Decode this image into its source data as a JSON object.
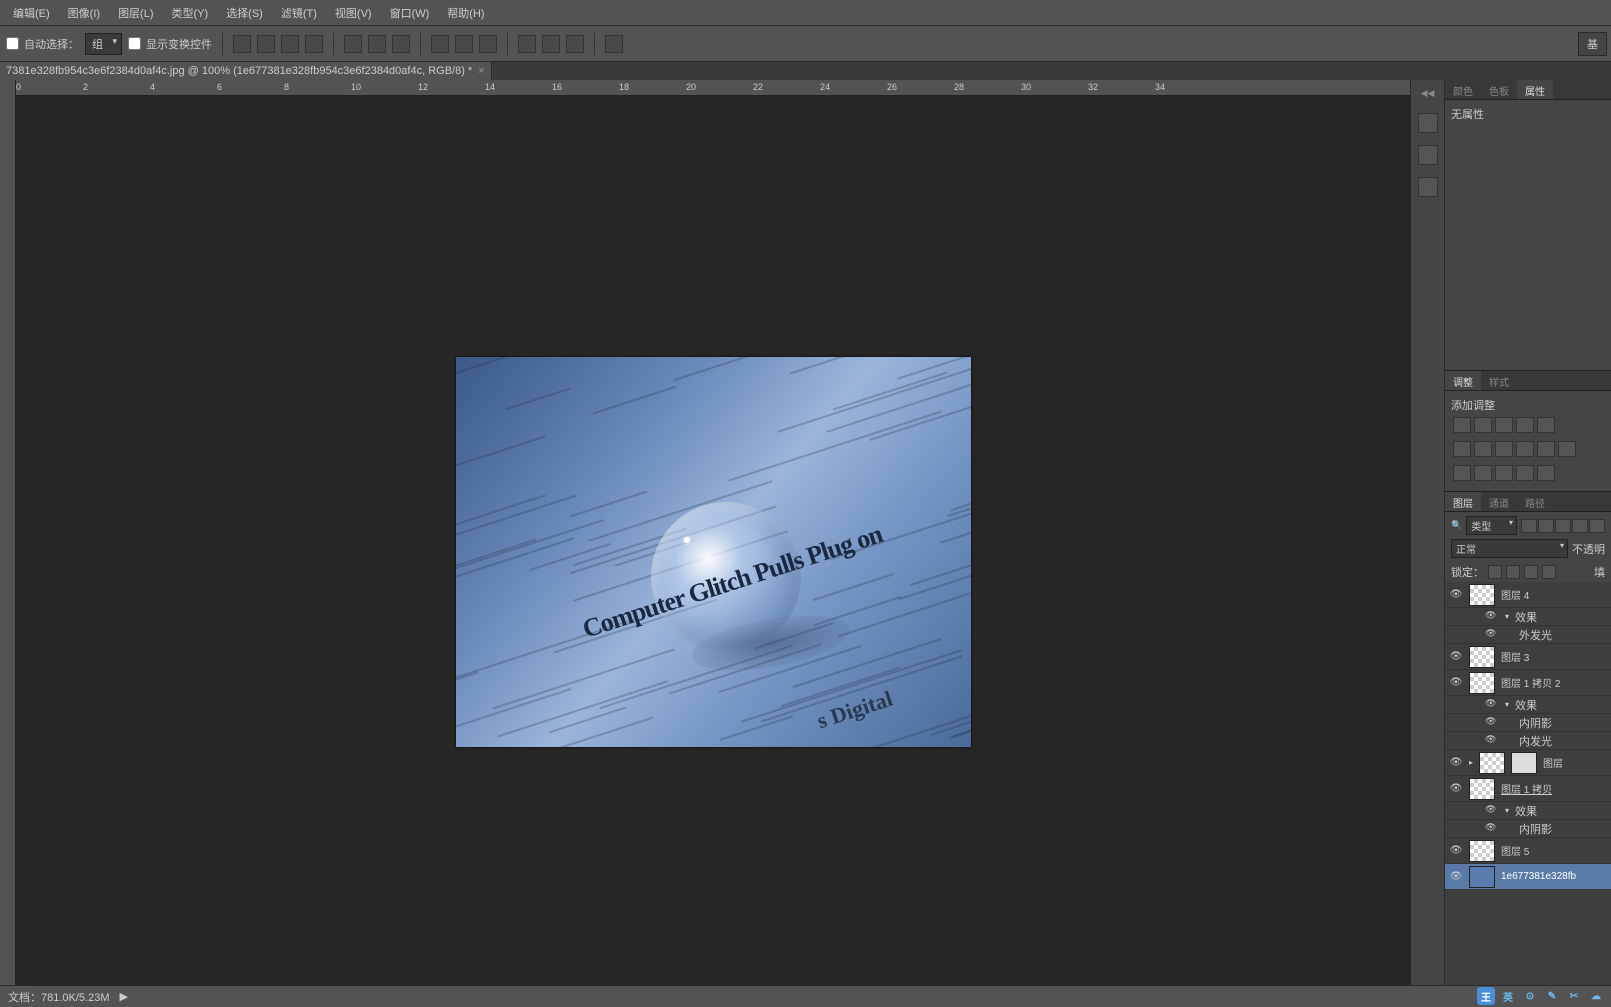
{
  "menu": {
    "items": [
      "编辑(E)",
      "图像(I)",
      "图层(L)",
      "类型(Y)",
      "选择(S)",
      "滤镜(T)",
      "视图(V)",
      "窗口(W)",
      "帮助(H)"
    ]
  },
  "optionsbar": {
    "auto_select": "自动选择：",
    "group": "组",
    "show_transform": "显示变换控件",
    "right_btn": "基"
  },
  "doc_tab": {
    "title": "7381e328fb954c3e6f2384d0af4c.jpg @ 100% (1e677381e328fb954c3e6f2384d0af4c, RGB/8) *"
  },
  "ruler": {
    "marks": [
      "0",
      "2",
      "4",
      "6",
      "8",
      "10",
      "12",
      "14",
      "16",
      "18",
      "20",
      "22",
      "24",
      "26",
      "28",
      "30",
      "32",
      "34"
    ]
  },
  "canvas": {
    "headline": "Computer Glitch Pulls Plug on",
    "headline2": "s Digital"
  },
  "panel_color": {
    "tabs": [
      "颜色",
      "色板",
      "属性"
    ],
    "none": "无属性"
  },
  "panel_adjust": {
    "tabs": [
      "调整",
      "样式"
    ],
    "add": "添加调整"
  },
  "panel_layers": {
    "tabs": [
      "图层",
      "通道",
      "路径"
    ],
    "filter_label": "类型",
    "blend": "正常",
    "opacity_label": "不透明",
    "lock_label": "锁定：",
    "fill_label": "填",
    "layers": [
      {
        "name": "图层 4",
        "fx": [
          "效果",
          "外发光"
        ]
      },
      {
        "name": "图层 3"
      },
      {
        "name": "图层 1 拷贝 2",
        "fx": [
          "效果",
          "内阴影",
          "内发光"
        ]
      },
      {
        "name": "图层",
        "mask": true
      },
      {
        "name": "图层 1 拷贝",
        "underline": true,
        "fx": [
          "效果",
          "内阴影"
        ]
      },
      {
        "name": "图层 5"
      },
      {
        "name": "1e677381e328fb",
        "blue": true,
        "selected": true
      }
    ]
  },
  "status": {
    "zoom": "文档：781.0K/5.23M"
  },
  "ime": {
    "a": "王",
    "b": "英"
  }
}
